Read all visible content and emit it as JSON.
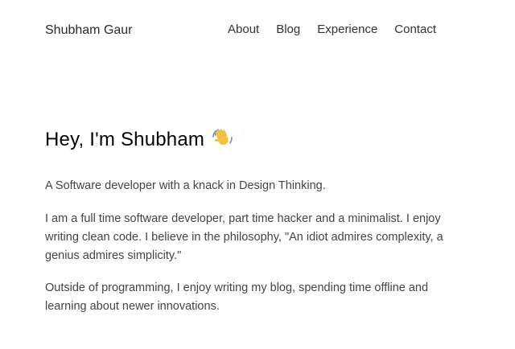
{
  "header": {
    "brand": "Shubham Gaur",
    "nav": [
      {
        "label": "About"
      },
      {
        "label": "Blog"
      },
      {
        "label": "Experience"
      },
      {
        "label": "Contact"
      }
    ]
  },
  "hero": {
    "title": "Hey, I'm Shubham",
    "wave_icon": "waving-hand-icon"
  },
  "intro": {
    "tagline": "A Software developer with a knack in Design Thinking.",
    "bio": "I am a full time software developer, part time hacker and a minimalist. I enjoy writing clean code. I believe in the philosophy, \"An idiot admires complexity, a genius admires simplicity.\"",
    "outside": "Outside of programming, I enjoy writing my blog, spending time offline and learning about newer innovations."
  },
  "colors": {
    "text": "#333333",
    "heading": "#000000",
    "wave": "#f5c33b"
  }
}
